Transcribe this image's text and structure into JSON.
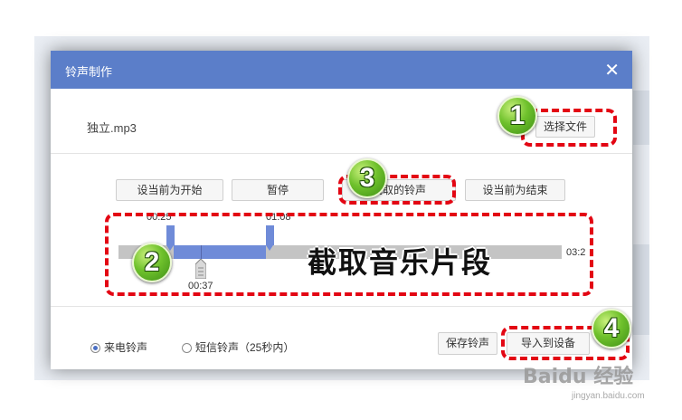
{
  "dialog": {
    "title": "铃声制作",
    "close_icon": "close-icon",
    "file_name": "独立.mp3",
    "choose_file_label": "选择文件"
  },
  "controls": {
    "set_start_label": "设当前为开始",
    "pause_label": "暂停",
    "play_clip_label": "截取的铃声",
    "set_end_label": "设当前为结束"
  },
  "timeline": {
    "start_time": "00:25",
    "end_time": "01:08",
    "current_time": "00:37",
    "total_time": "03:2"
  },
  "ringtone_type": {
    "incoming_label": "来电铃声",
    "sms_label": "短信铃声（25秒内）",
    "selected": "incoming"
  },
  "footer": {
    "save_label": "保存铃声",
    "import_label": "导入到设备"
  },
  "annotations": {
    "caption": "截取音乐片段",
    "step1": "1",
    "step2": "2",
    "step3": "3",
    "step4": "4"
  },
  "watermark": {
    "brand": "Baidu 经验",
    "url": "jingyan.baidu.com"
  },
  "colors": {
    "title_bar": "#5b7ec9",
    "selection": "#6f8bd8",
    "annotation_red": "#e30613",
    "badge_green": "#6fc12c"
  }
}
